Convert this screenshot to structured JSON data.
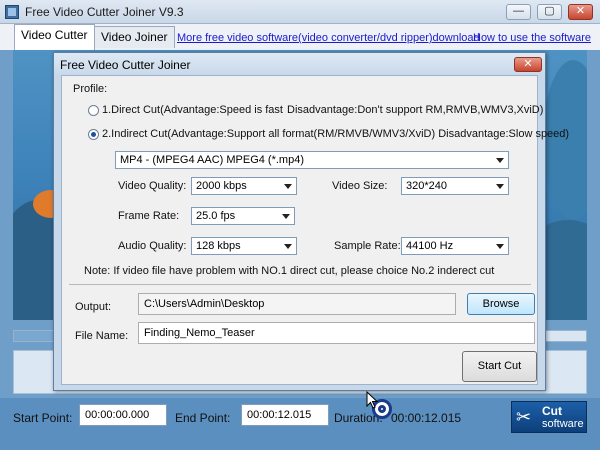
{
  "app": {
    "title": "Free Video Cutter Joiner V9.3",
    "controls": {
      "minimize": "—",
      "maximize": "▢",
      "close": "✕"
    }
  },
  "tabs": [
    {
      "label": "Video Cutter",
      "active": true
    },
    {
      "label": "Video Joiner",
      "active": false
    }
  ],
  "links": {
    "more_software": "More free video software(video converter/dvd ripper)download",
    "how_to": "How to use the software"
  },
  "bottom": {
    "start_label": "Start Point:",
    "start_value": "00:00:00.000",
    "end_label": "End Point:",
    "end_value": "00:00:12.015",
    "duration_label": "Duration:",
    "duration_value": "00:00:12.015"
  },
  "logo": {
    "line1": "Cut",
    "line2": "software"
  },
  "dialog": {
    "title": "Free Video Cutter Joiner",
    "close": "✕",
    "profile_label": "Profile:",
    "option1": {
      "label": "1.Direct Cut(Advantage:Speed is fast",
      "disadvantage": "Disadvantage:Don't support RM,RMVB,WMV3,XviD)",
      "selected": false
    },
    "option2": {
      "label": "2.Indirect Cut(Advantage:Support all format(RM/RMVB/WMV3/XviD) Disadvantage:Slow speed)",
      "selected": true
    },
    "format_value": "MP4 - (MPEG4 AAC) MPEG4 (*.mp4)",
    "video_quality_label": "Video Quality:",
    "video_quality_value": "2000 kbps",
    "video_size_label": "Video Size:",
    "video_size_value": "320*240",
    "frame_rate_label": "Frame Rate:",
    "frame_rate_value": "25.0 fps",
    "audio_quality_label": "Audio Quality:",
    "audio_quality_value": "128 kbps",
    "sample_rate_label": "Sample Rate:",
    "sample_rate_value": "44100 Hz",
    "note": "Note: If video file have problem with NO.1 direct cut, please choice No.2 inderect cut",
    "output_label": "Output:",
    "output_value": "C:\\Users\\Admin\\Desktop",
    "browse_label": "Browse",
    "filename_label": "File Name:",
    "filename_value": "Finding_Nemo_Teaser",
    "start_cut_label": "Start Cut"
  },
  "colors": {
    "video_bg": "#4f93c4",
    "link": "#1a1ad1",
    "close_red": "#c8442e",
    "dialog_frame": "#c7d8ea"
  }
}
